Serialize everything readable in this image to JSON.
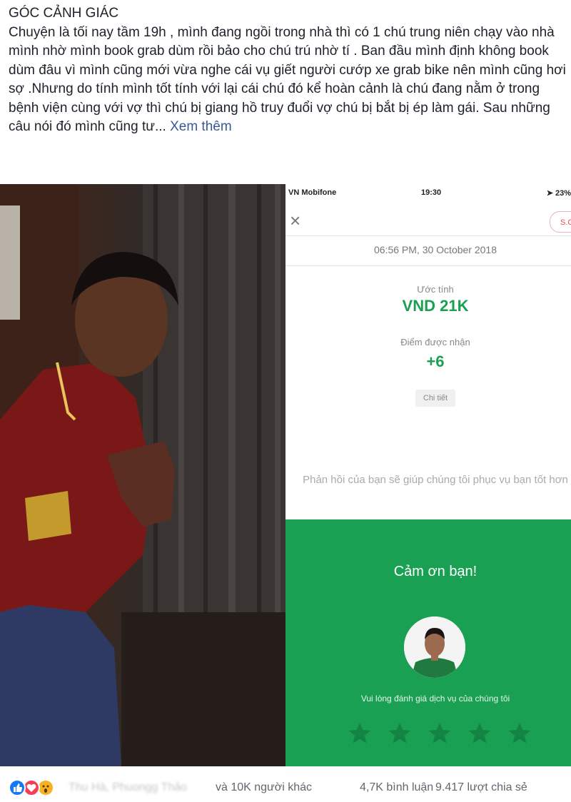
{
  "post": {
    "title": "GÓC CẢNH GIÁC",
    "body": "Chuyện là tối nay tầm 19h , mình đang ngồi trong nhà thì có 1 chú trung niên chạy vào nhà mình nhờ mình book grab dùm rồi bảo cho chú trú nhờ tí . Ban đầu mình định không book dùm đâu vì mình cũng mới vừa nghe cái vụ giết người cướp xe grab bike nên mình cũng hơi sợ .Nhưng do tính mình tốt tính với lại cái chú đó kể hoàn cảnh là chú đang nằm ở trong bệnh viện cùng với vợ thì chú bị giang hồ truy đuổi vợ chú bị bắt bị ép làm gái. Sau những câu nói đó mình cũng tư...",
    "see_more": "Xem thêm"
  },
  "phone": {
    "status": {
      "carrier": "VN Mobifone",
      "time": "19:30",
      "battery": "23%"
    },
    "close_icon": "close-icon",
    "corner_button": "S.O",
    "date": "06:56 PM, 30 October 2018",
    "estimate_label": "Ước tính",
    "estimate_value": "VND 21K",
    "points_label": "Điểm được nhận",
    "points_value": "+6",
    "detail_button": "Chi tiết",
    "feedback_text": "Phản hồi của bạn sẽ giúp chúng tôi phục vụ bạn tốt hơn",
    "thanks": "Cảm ơn bạn!",
    "rate_label": "Vui lòng đánh giá dịch vụ của chúng tôi",
    "star_count": 5,
    "rating_filled": 0
  },
  "reactions": {
    "icons": [
      "like-icon",
      "love-icon",
      "wow-icon"
    ],
    "names": "Thu Hà, Phuongg Thảo",
    "others": "và 10K người khác",
    "comments": "4,7K bình luận",
    "shares": "9.417 lượt chia sẻ"
  },
  "colors": {
    "grab_green": "#1aa053",
    "link_blue": "#385898",
    "like_blue": "#1877f2",
    "love_red": "#f33e58",
    "wow_yellow": "#f7b125"
  }
}
